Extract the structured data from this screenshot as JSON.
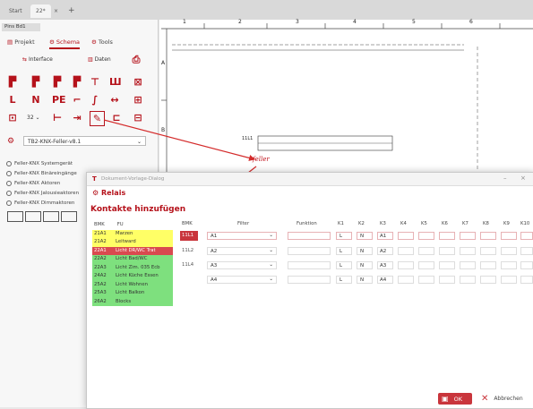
{
  "tabs": [
    {
      "label": "Start"
    },
    {
      "label": "22*"
    },
    {
      "label": "×"
    },
    {
      "label": "+"
    }
  ],
  "file_label": "Pins Bd1",
  "ribbon": {
    "tabs": [
      "Projekt",
      "Schema",
      "Tools"
    ],
    "row1": [
      "Interface",
      "Daten"
    ]
  },
  "template_select": "TB2-KNX-Feller-v8.1",
  "tree": [
    "Feller-KNX Systemgerät",
    "Feller-KNX Binäreingänge",
    "Feller-KNX Aktoren",
    "Feller-KNX Jalousieaktoren",
    "Feller-KNX Dimmaktoren"
  ],
  "canvas": {
    "columns": [
      "1",
      "2",
      "3",
      "4",
      "5",
      "6"
    ],
    "rows": [
      "A",
      "B"
    ],
    "box_label": "11L1"
  },
  "dialog": {
    "title": "Dokument-Vorlage-Dialog",
    "header_label": "Relais",
    "heading": "Kontakte hinzufügen",
    "bmk_header": [
      "BMK",
      "FU"
    ],
    "bmk_rows": [
      {
        "bmk": "21A1",
        "fu": "Marzen",
        "color": "#ffff66"
      },
      {
        "bmk": "21A2",
        "fu": "Leitward",
        "color": "#ffff66"
      },
      {
        "bmk": "22A1",
        "fu": "Licht DR/WC Trat",
        "color": "#d94a4f"
      },
      {
        "bmk": "22A2",
        "fu": "Licht Bad/WC",
        "color": "#7ee07e"
      },
      {
        "bmk": "22A3",
        "fu": "Licht Zim. 035 Ecb",
        "color": "#7ee07e"
      },
      {
        "bmk": "24A2",
        "fu": "Licht Küche Essen",
        "color": "#7ee07e"
      },
      {
        "bmk": "25A2",
        "fu": "Licht Wohnen",
        "color": "#7ee07e"
      },
      {
        "bmk": "25A3",
        "fu": "Licht Balkon",
        "color": "#7ee07e"
      },
      {
        "bmk": "26A2",
        "fu": "Blocks",
        "color": "#7ee07e"
      }
    ],
    "grid_headers": [
      "BMK",
      "Filter",
      "Funktion",
      "K1",
      "K2",
      "K3",
      "K4",
      "K5",
      "K6",
      "K7",
      "K8",
      "K9",
      "K10"
    ],
    "grid_rows": [
      {
        "bmk": "11L1",
        "filter": "A1",
        "k1": "L",
        "k2": "N",
        "k3": "A1"
      },
      {
        "bmk": "11L2",
        "filter": "A2",
        "k1": "L",
        "k2": "N",
        "k3": "A2"
      },
      {
        "bmk": "11L4",
        "filter": "A3",
        "k1": "L",
        "k2": "N",
        "k3": "A3"
      },
      {
        "bmk": "",
        "filter": "A4",
        "k1": "L",
        "k2": "N",
        "k3": "A4"
      }
    ],
    "ok_label": "OK",
    "cancel_label": "Abbrechen"
  },
  "colors": {
    "accent": "#b5121b",
    "selected_row": "#c9353c"
  }
}
